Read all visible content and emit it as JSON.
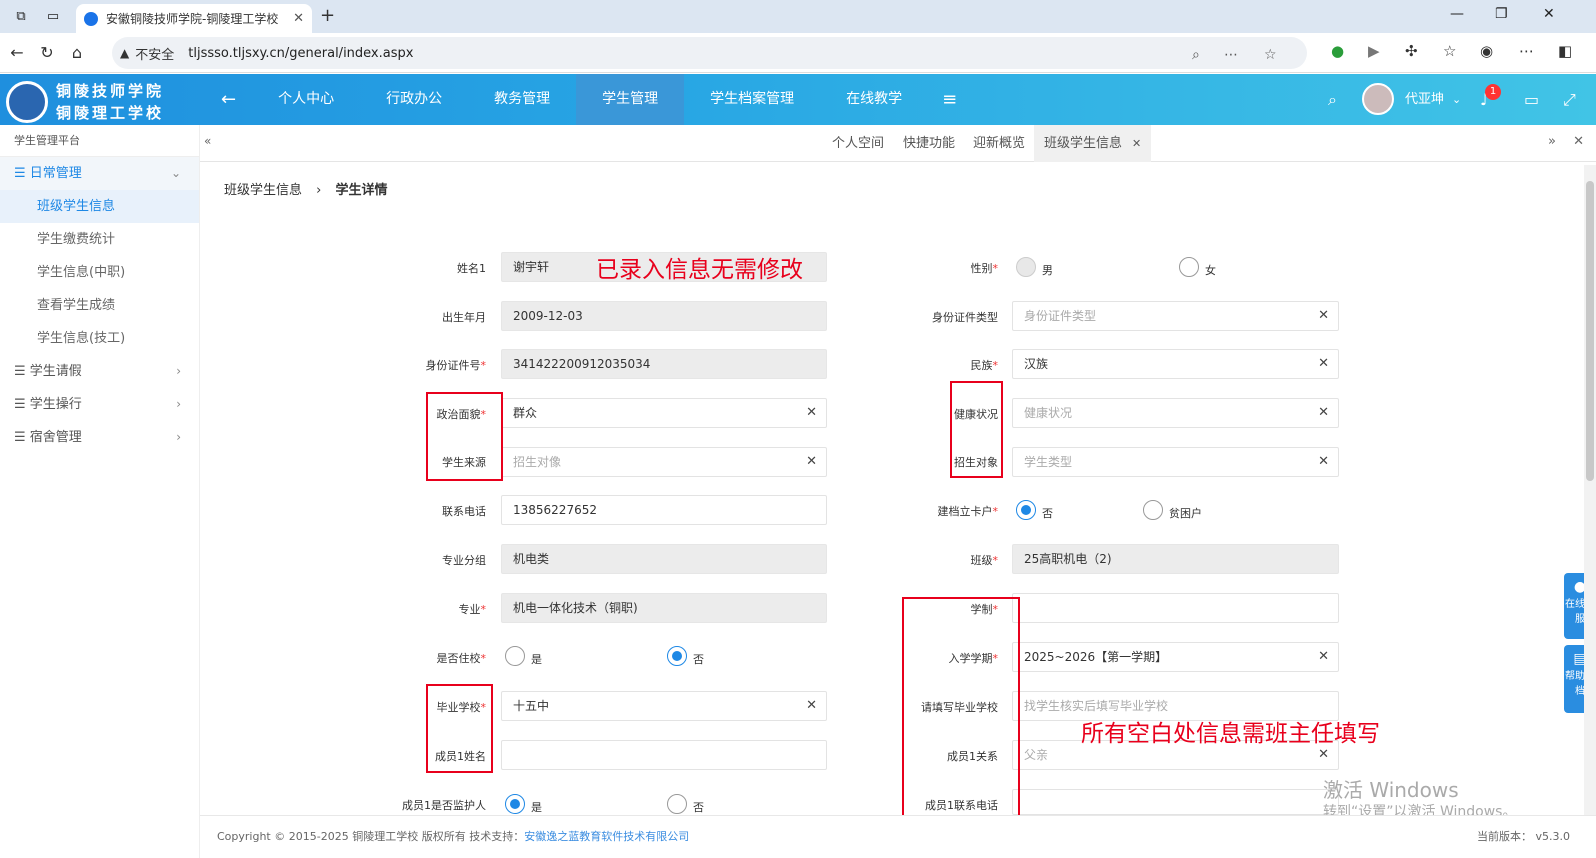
{
  "browser": {
    "tab_title": "安徽铜陵技师学院-铜陵理工学校",
    "not_secure": "不安全",
    "url": "tljssso.tljsxy.cn/general/index.aspx"
  },
  "header": {
    "logo_line1": "铜陵技师学院",
    "logo_line2": "铜陵理工学校",
    "nav": [
      "个人中心",
      "行政办公",
      "教务管理",
      "学生管理",
      "学生档案管理",
      "在线教学"
    ],
    "username": "代亚坤",
    "notify_count": "1"
  },
  "sidebar": {
    "title": "学生管理平台",
    "group_daily": "日常管理",
    "sub": [
      "班级学生信息",
      "学生缴费统计",
      "学生信息(中职)",
      "查看学生成绩",
      "学生信息(技工)"
    ],
    "group_leave": "学生请假",
    "group_conduct": "学生操行",
    "group_dorm": "宿舍管理"
  },
  "pagetabs": [
    "个人空间",
    "快捷功能",
    "迎新概览",
    "班级学生信息"
  ],
  "breadcrumb": {
    "parent": "班级学生信息",
    "current": "学生详情"
  },
  "form": {
    "name_label": "姓名1",
    "name_value": "谢宇轩",
    "gender_label": "性别",
    "gender_male": "男",
    "gender_female": "女",
    "birth_label": "出生年月",
    "birth_value": "2009-12-03",
    "idtype_label": "身份证件类型",
    "idtype_ph": "身份证件类型",
    "idno_label": "身份证件号",
    "idno_value": "341422200912035034",
    "nation_label": "民族",
    "nation_value": "汉族",
    "political_label": "政治面貌",
    "political_value": "群众",
    "health_label": "健康状况",
    "health_ph": "健康状况",
    "source_label": "学生来源",
    "source_ph": "招生对像",
    "target_label": "招生对象",
    "target_ph": "学生类型",
    "phone_label": "联系电话",
    "phone_value": "13856227652",
    "poor_label": "建档立卡户",
    "poor_no": "否",
    "poor_yes": "贫困户",
    "group_label": "专业分组",
    "group_value": "机电类",
    "class_label": "班级",
    "class_value": "25高职机电（2)",
    "major_label": "专业",
    "major_value": "机电一体化技术（铜职)",
    "system_label": "学制",
    "board_label": "是否住校",
    "board_yes": "是",
    "board_no": "否",
    "term_label": "入学学期",
    "term_value": "2025~2026【第一学期】",
    "school_label": "毕业学校",
    "school_value": "十五中",
    "school_fill_label": "请填写毕业学校",
    "school_fill_ph": "找学生核实后填写毕业学校",
    "member_name_label": "成员1姓名",
    "member_rel_label": "成员1关系",
    "member_rel_ph": "父亲",
    "guardian_label": "成员1是否监护人",
    "guardian_yes": "是",
    "guardian_no": "否",
    "member_phone_label": "成员1联系电话"
  },
  "annotations": {
    "note1": "已录入信息无需修改",
    "note2": "所有空白处信息需班主任填写"
  },
  "float_buttons": {
    "service": "在线客服",
    "help": "帮助文档"
  },
  "footer": {
    "copyright": "Copyright © 2015-2025  铜陵理工学校 版权所有  技术支持：",
    "company": "安徽逸之蓝教育软件技术有限公司",
    "version": "当前版本： v5.3.0"
  },
  "watermark": {
    "line1": "激活 Windows",
    "line2": "转到“设置”以激活 Windows。"
  },
  "colors": {
    "accent": "#1e88e5",
    "header_start": "#1f8fde",
    "header_end": "#41c4e6",
    "annotation_red": "#e8001c"
  }
}
